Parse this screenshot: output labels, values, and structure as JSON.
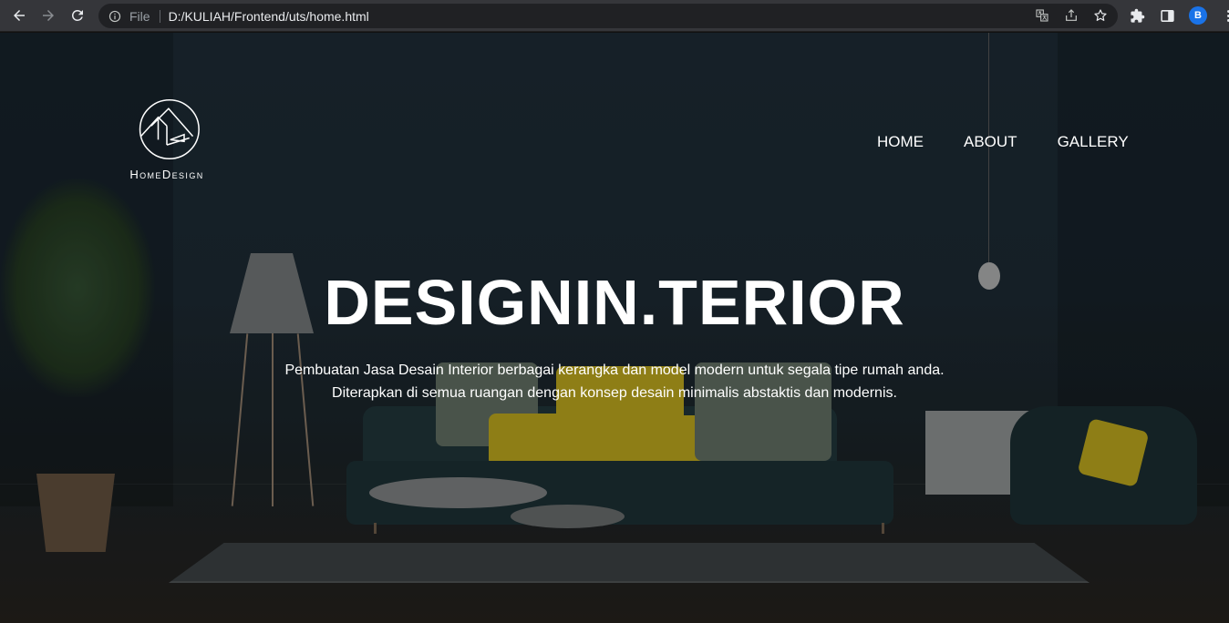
{
  "browser": {
    "file_label": "File",
    "url": "D:/KULIAH/Frontend/uts/home.html",
    "profile_initial": "B",
    "icons": [
      "back-arrow-icon",
      "forward-arrow-icon",
      "reload-icon",
      "info-icon",
      "translate-icon",
      "share-icon",
      "star-icon",
      "extensions-icon",
      "side-panel-icon",
      "kebab-menu-icon"
    ]
  },
  "logo": {
    "text": "HomeDesign"
  },
  "nav": {
    "items": [
      {
        "label": "HOME"
      },
      {
        "label": "ABOUT"
      },
      {
        "label": "GALLERY"
      }
    ]
  },
  "hero": {
    "title": "DESIGNIN.TERIOR",
    "line1": "Pembuatan Jasa Desain Interior berbagai kerangka dan model modern untuk segala tipe rumah anda.",
    "line2": "Diterapkan di semua ruangan dengan konsep desain minimalis abstaktis dan modernis."
  },
  "colors": {
    "chrome_bg": "#35363a",
    "omnibox_bg": "#202124",
    "hero_text": "#ffffff",
    "avatar": "#1a73e8",
    "pillow_yellow": "#b7a21d"
  }
}
